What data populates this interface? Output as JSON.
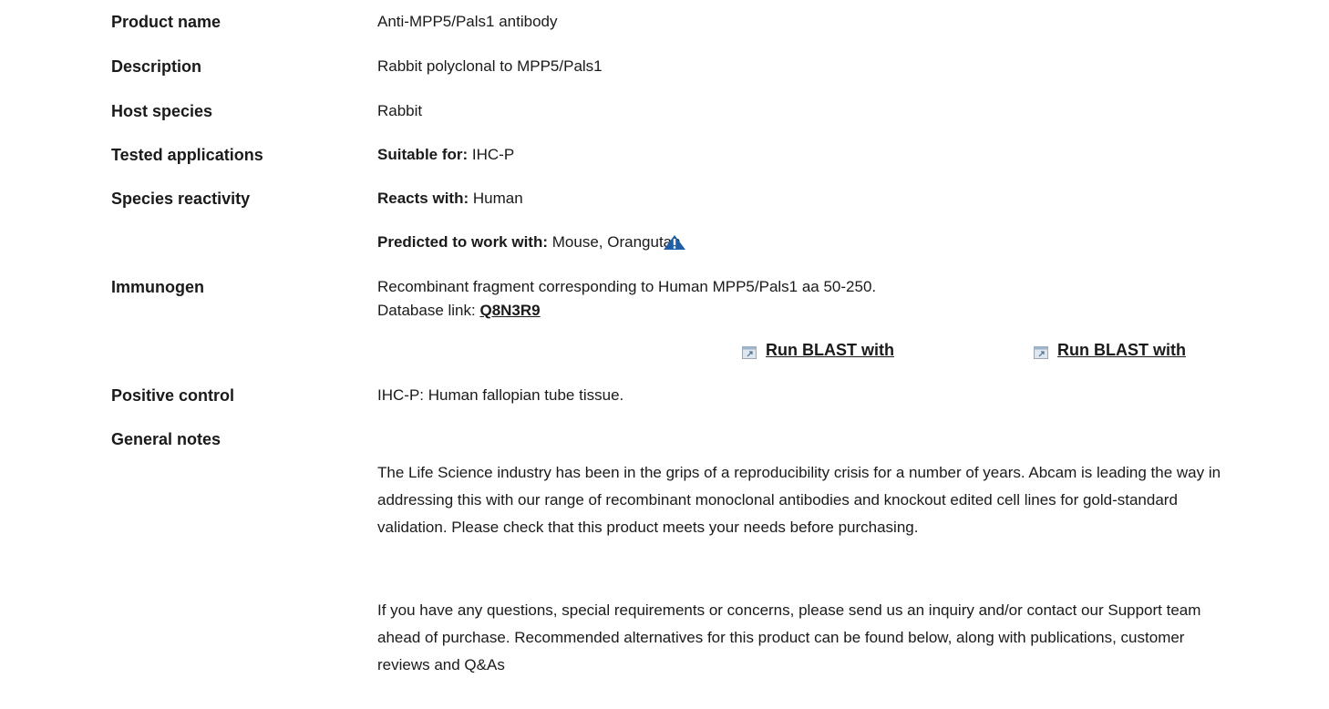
{
  "rows": {
    "product_name": {
      "label": "Product name",
      "value": "Anti-MPP5/Pals1 antibody"
    },
    "description": {
      "label": "Description",
      "value": "Rabbit polyclonal to MPP5/Pals1"
    },
    "host_species": {
      "label": "Host species",
      "value": "Rabbit"
    },
    "tested_applications": {
      "label": "Tested applications",
      "prefix": "Suitable for:",
      "value": "IHC-P"
    },
    "species_reactivity": {
      "label": "Species reactivity",
      "reacts_prefix": "Reacts with:",
      "reacts_value": "Human",
      "predicted_prefix": "Predicted to work with:",
      "predicted_value": "Mouse, Orangutan"
    },
    "immunogen": {
      "label": "Immunogen",
      "value": "Recombinant fragment corresponding to Human MPP5/Pals1 aa 50-250.",
      "db_prefix": "Database link:",
      "db_link": "Q8N3R9",
      "blast1": "Run BLAST with",
      "blast2": "Run BLAST with"
    },
    "positive_control": {
      "label": "Positive control",
      "value": "IHC-P: Human fallopian tube tissue."
    },
    "general_notes": {
      "label": "General notes",
      "para1": "The Life Science industry has been in the grips of a reproducibility crisis for a number of years. Abcam is leading the way in addressing this with our range of recombinant monoclonal antibodies and knockout edited cell lines for gold-standard validation. Please check that this product meets your needs before purchasing.",
      "para2": "If you have any questions, special requirements or concerns, please send us an inquiry and/or contact our Support team ahead of purchase. Recommended alternatives for this product can be found below, along with publications, customer reviews and Q&As"
    }
  },
  "icons": {
    "warning": "warning-triangle-icon",
    "external": "external-link-icon",
    "warning_color": "#1f5fa8"
  }
}
